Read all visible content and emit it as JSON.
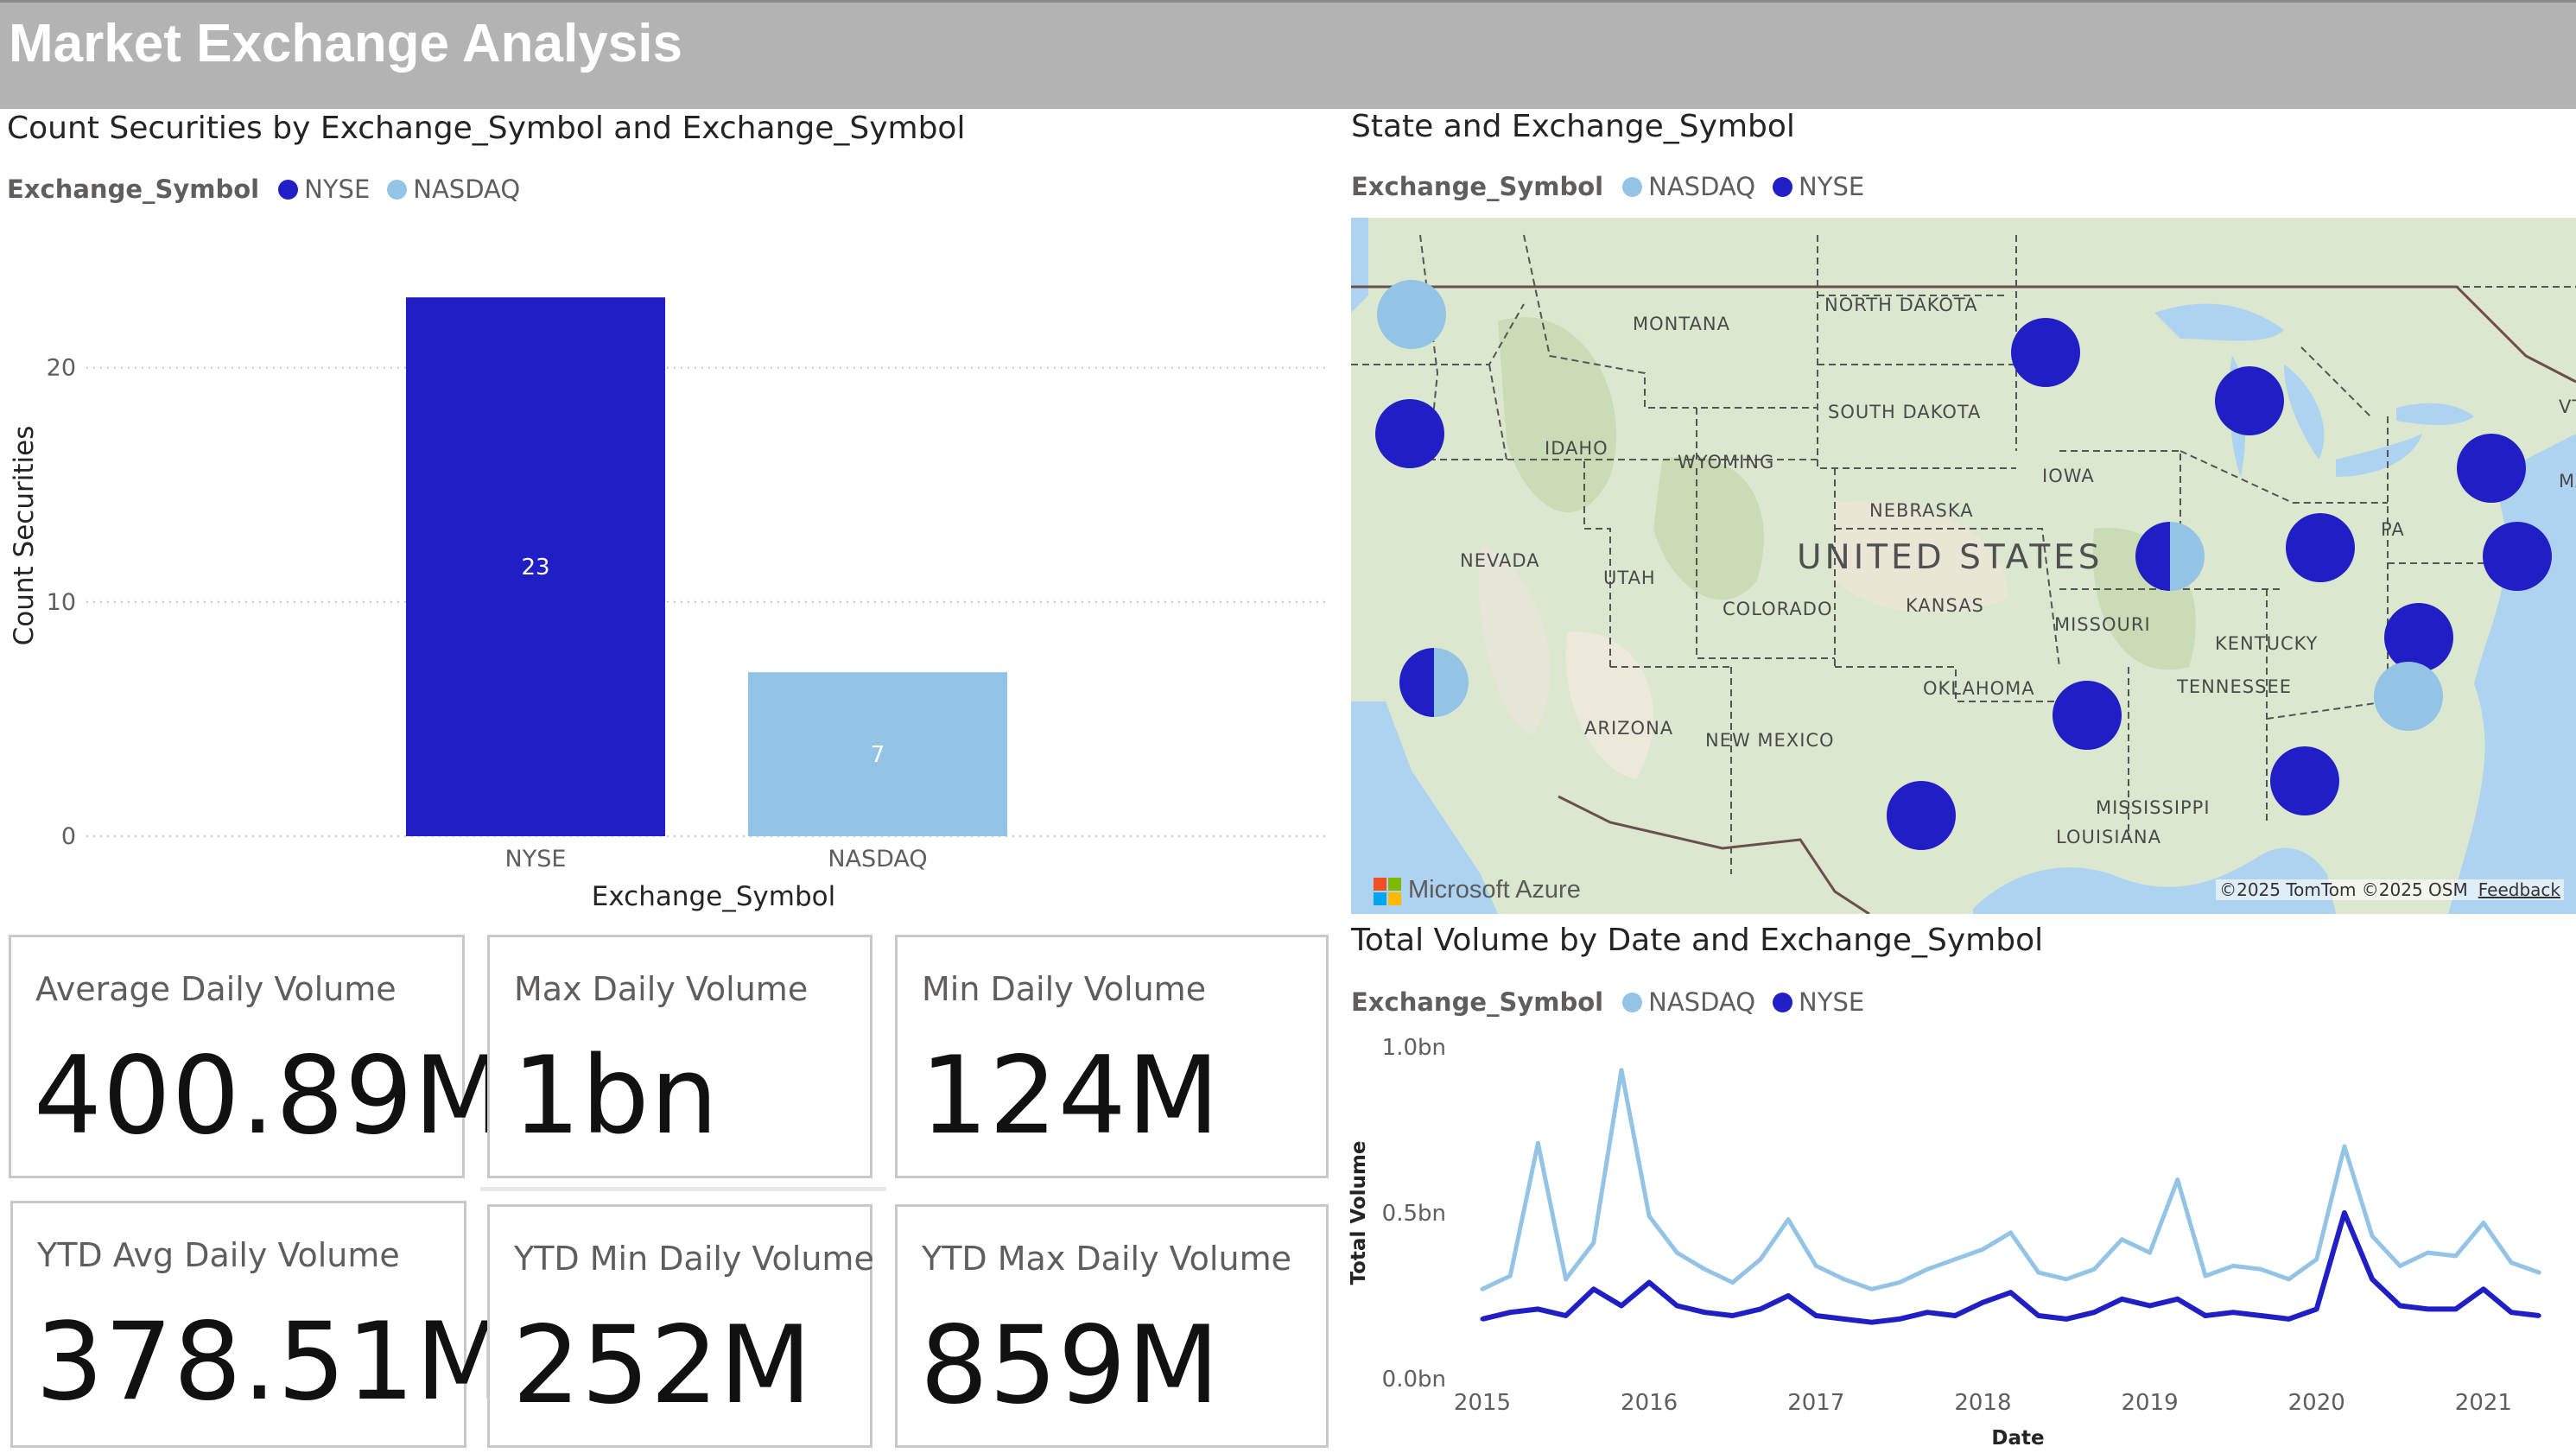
{
  "page": {
    "title": "Market Exchange Analysis"
  },
  "colors": {
    "nyse": "#1f1fc5",
    "nasdaq": "#93c4e6",
    "title_bar": "#b3b3b3"
  },
  "bar_visual": {
    "title": "Count Securities by Exchange_Symbol and Exchange_Symbol",
    "legend_title": "Exchange_Symbol",
    "legend": [
      "NYSE",
      "NASDAQ"
    ]
  },
  "map_visual": {
    "title": "State and Exchange_Symbol",
    "legend_title": "Exchange_Symbol",
    "legend": [
      "NASDAQ",
      "NYSE"
    ],
    "country_label": "UNITED STATES",
    "state_labels": [
      "MONTANA",
      "NORTH DAKOTA",
      "SOUTH DAKOTA",
      "IDAHO",
      "WYOMING",
      "NEBRASKA",
      "IOWA",
      "NEVADA",
      "UTAH",
      "COLORADO",
      "KANSAS",
      "MISSOURI",
      "KENTUCKY",
      "TENNESSEE",
      "OKLAHOMA",
      "ARIZONA",
      "NEW MEXICO",
      "MISSISSIPPI",
      "LOUISIANA",
      "PA",
      "VT",
      "MA"
    ],
    "brand": "Microsoft Azure",
    "attribution": "©2025 TomTom  ©2025 OSM",
    "feedback_link": "Feedback"
  },
  "line_visual": {
    "title": "Total Volume by Date and Exchange_Symbol",
    "legend_title": "Exchange_Symbol",
    "legend": [
      "NASDAQ",
      "NYSE"
    ]
  },
  "cards": [
    {
      "label": "Average Daily Volume",
      "value": "400.89M"
    },
    {
      "label": "Max Daily Volume",
      "value": "1bn"
    },
    {
      "label": "Min Daily Volume",
      "value": "124M"
    },
    {
      "label": "YTD Avg Daily Volume",
      "value": "378.51M"
    },
    {
      "label": "YTD Min Daily Volume",
      "value": "252M"
    },
    {
      "label": "YTD Max Daily Volume",
      "value": "859M"
    }
  ],
  "chart_data": [
    {
      "type": "bar",
      "title": "Count Securities by Exchange_Symbol and Exchange_Symbol",
      "categories": [
        "NYSE",
        "NASDAQ"
      ],
      "values": [
        23,
        7
      ],
      "data_labels": [
        "23",
        "7"
      ],
      "xlabel": "Exchange_Symbol",
      "ylabel": "Count Securities",
      "yticks": [
        "0",
        "10",
        "20"
      ],
      "ylim": [
        0,
        25
      ],
      "grid": true,
      "legend_position": "top-left"
    },
    {
      "type": "line",
      "title": "Total Volume by Date and Exchange_Symbol",
      "xlabel": "Date",
      "ylabel": "Total Volume",
      "xticks": [
        "2015",
        "2016",
        "2017",
        "2018",
        "2019",
        "2020",
        "2021"
      ],
      "yticks": [
        "0.0bn",
        "0.5bn",
        "1.0bn"
      ],
      "ylim": [
        0,
        1.0
      ],
      "grid": false,
      "legend_position": "top-left",
      "series": [
        {
          "name": "NASDAQ",
          "x": [
            "2015-01",
            "2015-03",
            "2015-05",
            "2015-07",
            "2015-09",
            "2015-11",
            "2016-01",
            "2016-03",
            "2016-05",
            "2016-07",
            "2016-09",
            "2016-11",
            "2017-01",
            "2017-03",
            "2017-05",
            "2017-07",
            "2017-09",
            "2017-11",
            "2018-01",
            "2018-03",
            "2018-05",
            "2018-07",
            "2018-09",
            "2018-11",
            "2019-01",
            "2019-03",
            "2019-05",
            "2019-07",
            "2019-09",
            "2019-11",
            "2020-01",
            "2020-03",
            "2020-05",
            "2020-07",
            "2020-09",
            "2020-11",
            "2021-01",
            "2021-03",
            "2021-05"
          ],
          "values": [
            0.27,
            0.31,
            0.71,
            0.3,
            0.41,
            0.93,
            0.49,
            0.38,
            0.33,
            0.29,
            0.36,
            0.48,
            0.34,
            0.3,
            0.27,
            0.29,
            0.33,
            0.36,
            0.39,
            0.44,
            0.32,
            0.3,
            0.33,
            0.42,
            0.38,
            0.6,
            0.31,
            0.34,
            0.33,
            0.3,
            0.36,
            0.7,
            0.43,
            0.34,
            0.38,
            0.37,
            0.47,
            0.35,
            0.32
          ]
        },
        {
          "name": "NYSE",
          "x": [
            "2015-01",
            "2015-03",
            "2015-05",
            "2015-07",
            "2015-09",
            "2015-11",
            "2016-01",
            "2016-03",
            "2016-05",
            "2016-07",
            "2016-09",
            "2016-11",
            "2017-01",
            "2017-03",
            "2017-05",
            "2017-07",
            "2017-09",
            "2017-11",
            "2018-01",
            "2018-03",
            "2018-05",
            "2018-07",
            "2018-09",
            "2018-11",
            "2019-01",
            "2019-03",
            "2019-05",
            "2019-07",
            "2019-09",
            "2019-11",
            "2020-01",
            "2020-03",
            "2020-05",
            "2020-07",
            "2020-09",
            "2020-11",
            "2021-01",
            "2021-03",
            "2021-05"
          ],
          "values": [
            0.18,
            0.2,
            0.21,
            0.19,
            0.27,
            0.22,
            0.29,
            0.22,
            0.2,
            0.19,
            0.21,
            0.25,
            0.19,
            0.18,
            0.17,
            0.18,
            0.2,
            0.19,
            0.23,
            0.26,
            0.19,
            0.18,
            0.2,
            0.24,
            0.22,
            0.24,
            0.19,
            0.2,
            0.19,
            0.18,
            0.21,
            0.5,
            0.3,
            0.22,
            0.21,
            0.21,
            0.27,
            0.2,
            0.19
          ]
        }
      ]
    }
  ]
}
